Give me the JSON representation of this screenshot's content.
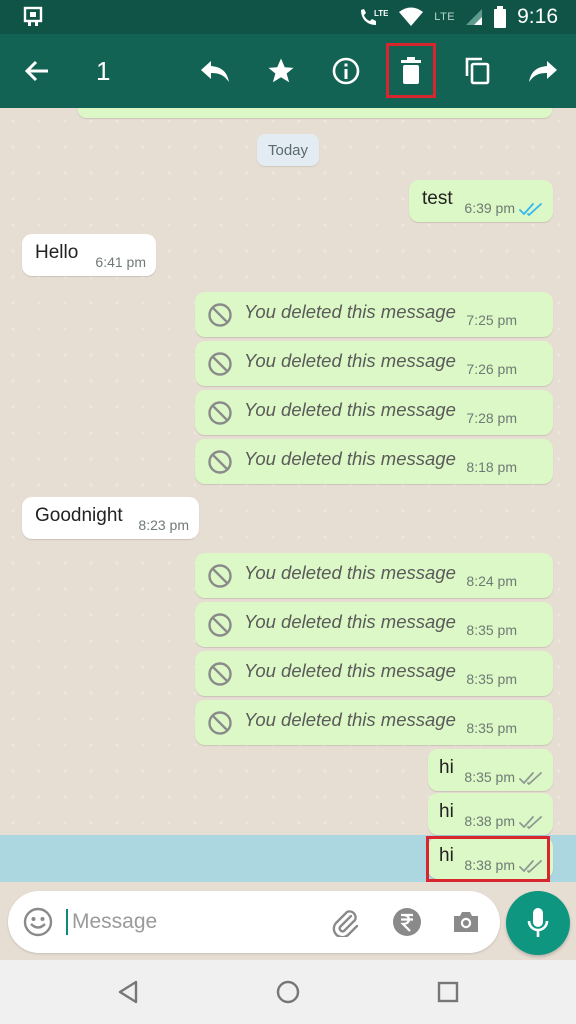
{
  "status_bar": {
    "time": "9:16",
    "network": "LTE",
    "network2": "LTE",
    "icons": [
      "notification-icon",
      "volte-call-icon",
      "wifi-icon",
      "signal-icon",
      "battery-icon"
    ]
  },
  "action_bar": {
    "selected_count": "1",
    "icons": [
      "back-arrow-icon",
      "reply-icon",
      "star-icon",
      "info-icon",
      "delete-icon",
      "copy-icon",
      "forward-icon"
    ],
    "highlight_color": "#d7262e"
  },
  "chat": {
    "date_chip": "Today",
    "messages": [
      {
        "dir": "out",
        "text": "test",
        "time": "6:39 pm",
        "ticks": "read"
      },
      {
        "dir": "in",
        "text": "Hello",
        "time": "6:41 pm"
      },
      {
        "dir": "out",
        "deleted": true,
        "text": "You deleted this message",
        "time": "7:25 pm"
      },
      {
        "dir": "out",
        "deleted": true,
        "text": "You deleted this message",
        "time": "7:26 pm"
      },
      {
        "dir": "out",
        "deleted": true,
        "text": "You deleted this message",
        "time": "7:28 pm"
      },
      {
        "dir": "out",
        "deleted": true,
        "text": "You deleted this message",
        "time": "8:18 pm"
      },
      {
        "dir": "in",
        "text": "Goodnight",
        "time": "8:23 pm"
      },
      {
        "dir": "out",
        "deleted": true,
        "text": "You deleted this message",
        "time": "8:24 pm"
      },
      {
        "dir": "out",
        "deleted": true,
        "text": "You deleted this message",
        "time": "8:35 pm"
      },
      {
        "dir": "out",
        "deleted": true,
        "text": "You deleted this message",
        "time": "8:35 pm"
      },
      {
        "dir": "out",
        "deleted": true,
        "text": "You deleted this message",
        "time": "8:35 pm"
      },
      {
        "dir": "out",
        "text": "hi",
        "time": "8:35 pm",
        "ticks": "delivered"
      },
      {
        "dir": "out",
        "text": "hi",
        "time": "8:38 pm",
        "ticks": "delivered"
      },
      {
        "dir": "out",
        "text": "hi",
        "time": "8:38 pm",
        "ticks": "delivered",
        "selected": true
      }
    ]
  },
  "composer": {
    "placeholder": "Message",
    "icons": [
      "emoji-icon",
      "attach-icon",
      "rupee-payment-icon",
      "camera-icon",
      "mic-icon"
    ]
  },
  "nav_bar": {
    "icons": [
      "back-triangle-icon",
      "home-circle-icon",
      "recents-square-icon"
    ]
  },
  "colors": {
    "header": "#136354",
    "status": "#0f5447",
    "outgoing_bubble": "#dcf8c6",
    "incoming_bubble": "#ffffff",
    "read_ticks": "#34b7f1",
    "selection": "#a9d6e2",
    "mic_button": "#0e9680"
  }
}
